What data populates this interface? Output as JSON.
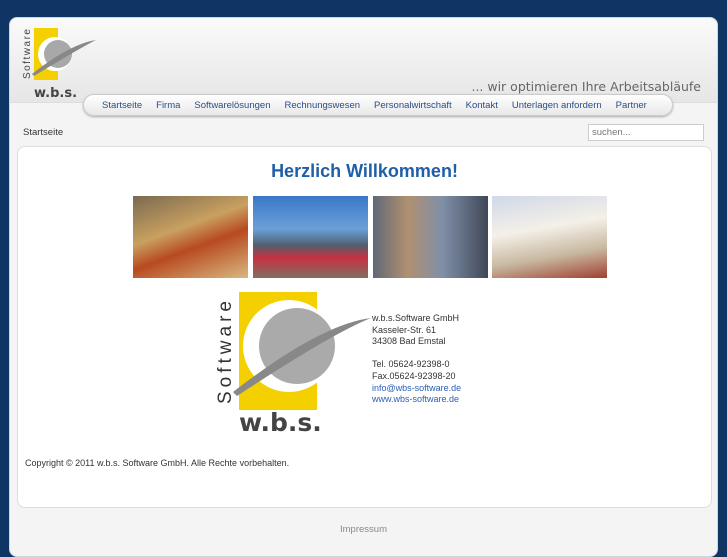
{
  "header": {
    "logo_text": "w.b.s.",
    "logo_vertical": "Software",
    "slogan": "... wir optimieren Ihre Arbeitsabläufe"
  },
  "nav": [
    "Startseite",
    "Firma",
    "Softwarelösungen",
    "Rechnungswesen",
    "Personalwirtschaft",
    "Kontakt",
    "Unterlagen anfordern",
    "Partner"
  ],
  "breadcrumb": "Startseite",
  "search": {
    "placeholder": "suchen..."
  },
  "main": {
    "title": "Herzlich Willkommen!",
    "address": {
      "company": "w.b.s.Software GmbH",
      "street": "Kasseler-Str. 61",
      "city": "34308 Bad Emstal",
      "tel": "Tel. 05624-92398-0",
      "fax": "Fax.05624-92398-20",
      "email": "info@wbs-software.de",
      "web": "www.wbs-software.de"
    },
    "copyright": "Copyright © 2011 w.b.s. Software GmbH. Alle Rechte vorbehalten."
  },
  "footer": {
    "impressum": "Impressum"
  }
}
